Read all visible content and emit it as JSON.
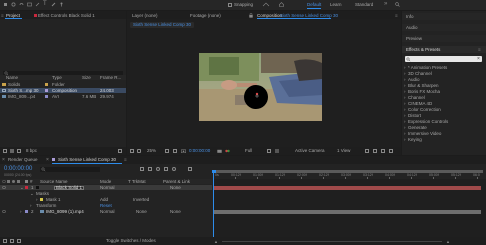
{
  "colors": {
    "accent_blue": "#2d8ceb",
    "red_label": "#c8283d",
    "track_red": "#a04a4a",
    "track_grey": "#6e6e6e",
    "bg": "#1c1c1c"
  },
  "toolbar": {
    "snapping_label": "Snapping",
    "workspaces": [
      "Default",
      "Learn",
      "Standard"
    ],
    "active_workspace": "Default"
  },
  "project_panel": {
    "tab_project": "Project",
    "tab_effect_controls": "Effect Controls Black Solid 1",
    "columns": {
      "name": "Name",
      "type": "Type",
      "size": "Size",
      "frame_rate": "Frame R..."
    },
    "items": [
      {
        "name": "Solids",
        "type": "Folder",
        "size": "",
        "fps": ""
      },
      {
        "name": "Sixth S...mp 30",
        "type": "Composition",
        "size": "",
        "fps": "24.003"
      },
      {
        "name": "IMG_809...p4",
        "type": "AVI",
        "size": "7.6 MB",
        "fps": "29.974"
      }
    ],
    "bpc_label": "8 bpc"
  },
  "viewer": {
    "tab_layer": "Layer (none)",
    "tab_footage": "Footage (none)",
    "tab_composition": "Composition",
    "comp_name": "Sixth Sense Linked Comp 30",
    "breadcrumb": "Sixth Sense Linked Comp 30",
    "zoom": "25%",
    "time": "0:00:00:00",
    "resolution": "Full",
    "camera": "Active Camera",
    "views": "1 View"
  },
  "right_panel": {
    "sections": [
      "Info",
      "Audio",
      "Preview"
    ],
    "effects_title": "Effects & Presets",
    "search_placeholder": "",
    "categories": [
      "* Animation Presets",
      "3D Channel",
      "Audio",
      "Blur & Sharpen",
      "Boris FX Mocha",
      "Channel",
      "CINEMA 4D",
      "Color Correction",
      "Distort",
      "Expression Controls",
      "Generate",
      "Immersive Video",
      "Keying"
    ]
  },
  "timeline": {
    "tab_render_queue": "Render Queue",
    "tab_comp": "Sixth Sense Linked Comp 30",
    "timecode": "0:00:00:00",
    "fps_sub": "00000 (24.00 fps)",
    "columns": {
      "source_name": "Source Name",
      "mode": "Mode",
      "trkmat": "T TrkMat",
      "parent": "Parent & Link"
    },
    "layers": [
      {
        "num": "1",
        "name": "Black Solid 1",
        "mode": "Normal",
        "trkmat": "",
        "parent": "None",
        "selected": true
      },
      {
        "num": "",
        "name": "Masks",
        "mode": "",
        "trkmat": "",
        "parent": "",
        "sub": true
      },
      {
        "num": "",
        "name": "Mask 1",
        "mode": "Add",
        "trkmat": "Inverted",
        "parent": "",
        "sub2": true
      },
      {
        "num": "",
        "name": "Transform",
        "mode": "Reset",
        "trkmat": "",
        "parent": "",
        "sub": true
      },
      {
        "num": "2",
        "name": "IMG_8099 (1).mp4",
        "mode": "Normal",
        "trkmat": "None",
        "parent": "None"
      }
    ],
    "ruler_ticks": [
      "0s",
      "00:12f",
      "01:00f",
      "01:12f",
      "02:00f",
      "02:12f",
      "03:00f",
      "03:12f",
      "04:00f",
      "04:12f",
      "05:00f",
      "05:12f",
      "06:0"
    ],
    "footer": "Toggle Switches / Modes"
  }
}
